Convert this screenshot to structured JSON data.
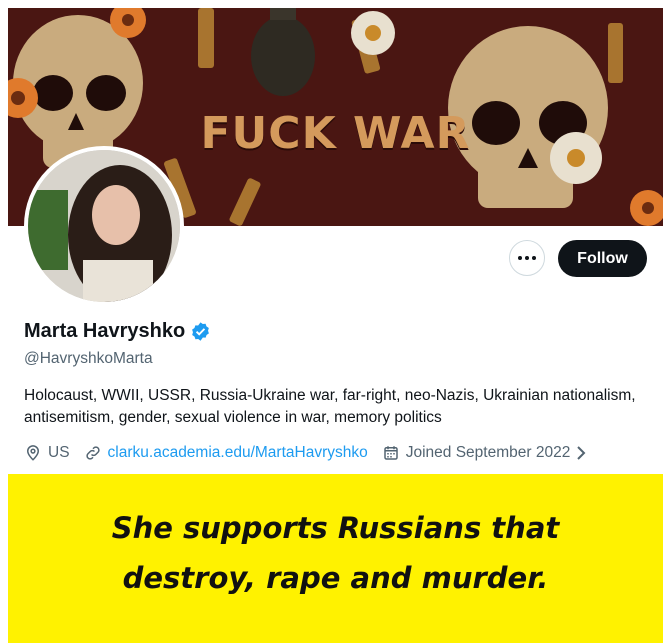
{
  "banner": {
    "text": "FUCK WAR"
  },
  "profile": {
    "name": "Marta Havryshko",
    "handle": "@HavryshkoMarta",
    "bio": "Holocaust, WWII, USSR, Russia-Ukraine war, far-right, neo-Nazis, Ukrainian nationalism, antisemitism, gender, sexual violence in war, memory politics",
    "location": "US",
    "website": "clarku.academia.edu/MartaHavryshko",
    "joined": "Joined September 2022"
  },
  "actions": {
    "follow_label": "Follow"
  },
  "overlay": {
    "line1": "She supports Russians that",
    "line2": "destroy, rape and murder."
  },
  "colors": {
    "accent": "#1d9bf0",
    "overlay_bg": "#fff200",
    "banner_bg": "#4a1612",
    "banner_text": "#d49a5c"
  },
  "icons": [
    "more-icon",
    "verified-badge-icon",
    "location-icon",
    "link-icon",
    "calendar-icon",
    "chevron-right-icon"
  ]
}
